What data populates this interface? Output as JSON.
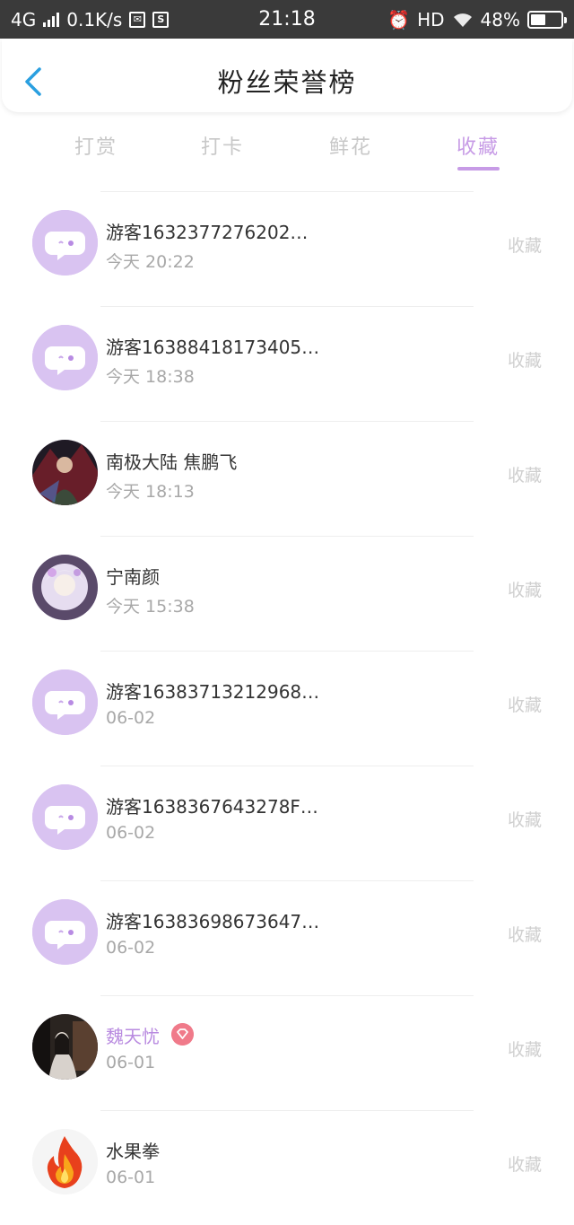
{
  "status_bar": {
    "network": "4G",
    "speed": "0.1K/s",
    "time": "21:18",
    "hd": "HD",
    "battery": "48%",
    "battery_level": 0.48
  },
  "header": {
    "title": "粉丝荣誉榜"
  },
  "tabs": [
    {
      "label": "打赏"
    },
    {
      "label": "打卡"
    },
    {
      "label": "鲜花"
    },
    {
      "label": "收藏"
    }
  ],
  "active_tab": "收藏",
  "accent_color": "#c79be6",
  "rows": [
    {
      "name": "游客1632377276202…",
      "time": "今天 20:22",
      "action": "收藏",
      "avatar": "guest-bubble"
    },
    {
      "name": "游客16388418173405…",
      "time": "今天 18:38",
      "action": "收藏",
      "avatar": "guest-bubble"
    },
    {
      "name": "南极大陆 焦鹏飞",
      "time": "今天 18:13",
      "action": "收藏",
      "avatar": "photo-dark"
    },
    {
      "name": "宁南颜",
      "time": "今天 15:38",
      "action": "收藏",
      "avatar": "photo-anime"
    },
    {
      "name": "游客16383713212968…",
      "time": "06-02",
      "action": "收藏",
      "avatar": "guest-bubble"
    },
    {
      "name": "游客1638367643278F…",
      "time": "06-02",
      "action": "收藏",
      "avatar": "guest-bubble"
    },
    {
      "name": "游客16383698673647…",
      "time": "06-02",
      "action": "收藏",
      "avatar": "guest-bubble"
    },
    {
      "name": "魏天忧",
      "time": "06-01",
      "action": "收藏",
      "avatar": "photo-room",
      "vip": true
    },
    {
      "name": "水果拳",
      "time": "06-01",
      "action": "收藏",
      "avatar": "flame"
    }
  ]
}
